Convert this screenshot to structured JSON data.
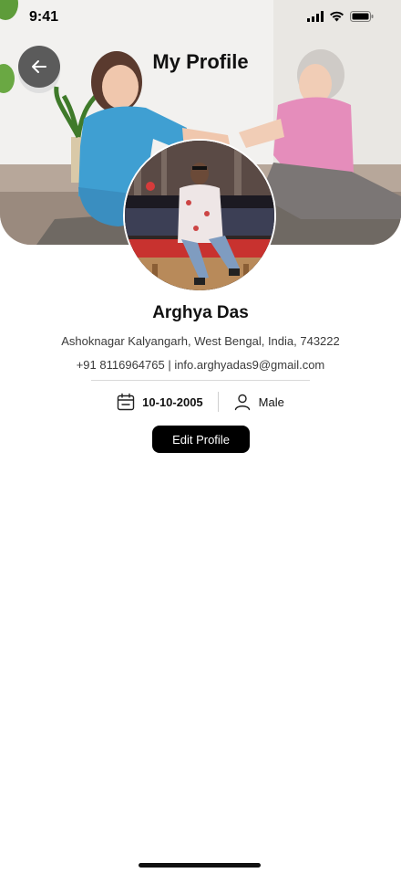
{
  "status_bar": {
    "time": "9:41",
    "icons": [
      "signal-icon",
      "wifi-icon",
      "battery-icon"
    ]
  },
  "header": {
    "title": "My Profile",
    "back_icon": "arrow-left-icon"
  },
  "profile": {
    "name": "Arghya Das",
    "address": "Ashoknagar Kalyangarh, West Bengal, India, 743222",
    "contact": "+91 8116964765 | info.arghyadas9@gmail.com",
    "dob": "10-10-2005",
    "dob_icon": "calendar-icon",
    "gender": "Male",
    "gender_icon": "user-icon"
  },
  "actions": {
    "edit_profile_label": "Edit Profile"
  },
  "colors": {
    "primary": "#000000",
    "back_button": "#5b5b5b",
    "text_secondary": "#3a3a3a"
  }
}
